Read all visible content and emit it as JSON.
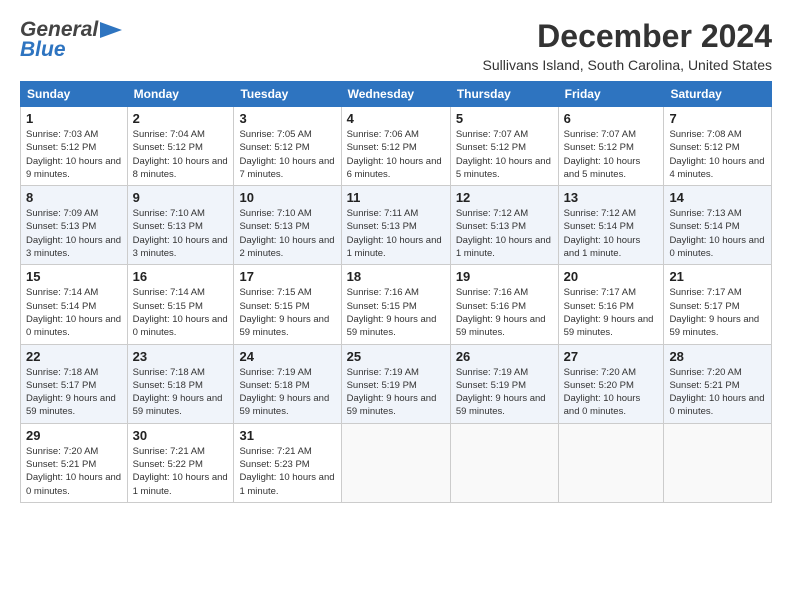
{
  "logo": {
    "line1": "General",
    "line2": "Blue"
  },
  "header": {
    "month_year": "December 2024",
    "location": "Sullivans Island, South Carolina, United States"
  },
  "days_of_week": [
    "Sunday",
    "Monday",
    "Tuesday",
    "Wednesday",
    "Thursday",
    "Friday",
    "Saturday"
  ],
  "weeks": [
    [
      {
        "day": "1",
        "sunrise": "Sunrise: 7:03 AM",
        "sunset": "Sunset: 5:12 PM",
        "daylight": "Daylight: 10 hours and 9 minutes."
      },
      {
        "day": "2",
        "sunrise": "Sunrise: 7:04 AM",
        "sunset": "Sunset: 5:12 PM",
        "daylight": "Daylight: 10 hours and 8 minutes."
      },
      {
        "day": "3",
        "sunrise": "Sunrise: 7:05 AM",
        "sunset": "Sunset: 5:12 PM",
        "daylight": "Daylight: 10 hours and 7 minutes."
      },
      {
        "day": "4",
        "sunrise": "Sunrise: 7:06 AM",
        "sunset": "Sunset: 5:12 PM",
        "daylight": "Daylight: 10 hours and 6 minutes."
      },
      {
        "day": "5",
        "sunrise": "Sunrise: 7:07 AM",
        "sunset": "Sunset: 5:12 PM",
        "daylight": "Daylight: 10 hours and 5 minutes."
      },
      {
        "day": "6",
        "sunrise": "Sunrise: 7:07 AM",
        "sunset": "Sunset: 5:12 PM",
        "daylight": "Daylight: 10 hours and 5 minutes."
      },
      {
        "day": "7",
        "sunrise": "Sunrise: 7:08 AM",
        "sunset": "Sunset: 5:12 PM",
        "daylight": "Daylight: 10 hours and 4 minutes."
      }
    ],
    [
      {
        "day": "8",
        "sunrise": "Sunrise: 7:09 AM",
        "sunset": "Sunset: 5:13 PM",
        "daylight": "Daylight: 10 hours and 3 minutes."
      },
      {
        "day": "9",
        "sunrise": "Sunrise: 7:10 AM",
        "sunset": "Sunset: 5:13 PM",
        "daylight": "Daylight: 10 hours and 3 minutes."
      },
      {
        "day": "10",
        "sunrise": "Sunrise: 7:10 AM",
        "sunset": "Sunset: 5:13 PM",
        "daylight": "Daylight: 10 hours and 2 minutes."
      },
      {
        "day": "11",
        "sunrise": "Sunrise: 7:11 AM",
        "sunset": "Sunset: 5:13 PM",
        "daylight": "Daylight: 10 hours and 1 minute."
      },
      {
        "day": "12",
        "sunrise": "Sunrise: 7:12 AM",
        "sunset": "Sunset: 5:13 PM",
        "daylight": "Daylight: 10 hours and 1 minute."
      },
      {
        "day": "13",
        "sunrise": "Sunrise: 7:12 AM",
        "sunset": "Sunset: 5:14 PM",
        "daylight": "Daylight: 10 hours and 1 minute."
      },
      {
        "day": "14",
        "sunrise": "Sunrise: 7:13 AM",
        "sunset": "Sunset: 5:14 PM",
        "daylight": "Daylight: 10 hours and 0 minutes."
      }
    ],
    [
      {
        "day": "15",
        "sunrise": "Sunrise: 7:14 AM",
        "sunset": "Sunset: 5:14 PM",
        "daylight": "Daylight: 10 hours and 0 minutes."
      },
      {
        "day": "16",
        "sunrise": "Sunrise: 7:14 AM",
        "sunset": "Sunset: 5:15 PM",
        "daylight": "Daylight: 10 hours and 0 minutes."
      },
      {
        "day": "17",
        "sunrise": "Sunrise: 7:15 AM",
        "sunset": "Sunset: 5:15 PM",
        "daylight": "Daylight: 9 hours and 59 minutes."
      },
      {
        "day": "18",
        "sunrise": "Sunrise: 7:16 AM",
        "sunset": "Sunset: 5:15 PM",
        "daylight": "Daylight: 9 hours and 59 minutes."
      },
      {
        "day": "19",
        "sunrise": "Sunrise: 7:16 AM",
        "sunset": "Sunset: 5:16 PM",
        "daylight": "Daylight: 9 hours and 59 minutes."
      },
      {
        "day": "20",
        "sunrise": "Sunrise: 7:17 AM",
        "sunset": "Sunset: 5:16 PM",
        "daylight": "Daylight: 9 hours and 59 minutes."
      },
      {
        "day": "21",
        "sunrise": "Sunrise: 7:17 AM",
        "sunset": "Sunset: 5:17 PM",
        "daylight": "Daylight: 9 hours and 59 minutes."
      }
    ],
    [
      {
        "day": "22",
        "sunrise": "Sunrise: 7:18 AM",
        "sunset": "Sunset: 5:17 PM",
        "daylight": "Daylight: 9 hours and 59 minutes."
      },
      {
        "day": "23",
        "sunrise": "Sunrise: 7:18 AM",
        "sunset": "Sunset: 5:18 PM",
        "daylight": "Daylight: 9 hours and 59 minutes."
      },
      {
        "day": "24",
        "sunrise": "Sunrise: 7:19 AM",
        "sunset": "Sunset: 5:18 PM",
        "daylight": "Daylight: 9 hours and 59 minutes."
      },
      {
        "day": "25",
        "sunrise": "Sunrise: 7:19 AM",
        "sunset": "Sunset: 5:19 PM",
        "daylight": "Daylight: 9 hours and 59 minutes."
      },
      {
        "day": "26",
        "sunrise": "Sunrise: 7:19 AM",
        "sunset": "Sunset: 5:19 PM",
        "daylight": "Daylight: 9 hours and 59 minutes."
      },
      {
        "day": "27",
        "sunrise": "Sunrise: 7:20 AM",
        "sunset": "Sunset: 5:20 PM",
        "daylight": "Daylight: 10 hours and 0 minutes."
      },
      {
        "day": "28",
        "sunrise": "Sunrise: 7:20 AM",
        "sunset": "Sunset: 5:21 PM",
        "daylight": "Daylight: 10 hours and 0 minutes."
      }
    ],
    [
      {
        "day": "29",
        "sunrise": "Sunrise: 7:20 AM",
        "sunset": "Sunset: 5:21 PM",
        "daylight": "Daylight: 10 hours and 0 minutes."
      },
      {
        "day": "30",
        "sunrise": "Sunrise: 7:21 AM",
        "sunset": "Sunset: 5:22 PM",
        "daylight": "Daylight: 10 hours and 1 minute."
      },
      {
        "day": "31",
        "sunrise": "Sunrise: 7:21 AM",
        "sunset": "Sunset: 5:23 PM",
        "daylight": "Daylight: 10 hours and 1 minute."
      },
      {
        "day": "",
        "sunrise": "",
        "sunset": "",
        "daylight": ""
      },
      {
        "day": "",
        "sunrise": "",
        "sunset": "",
        "daylight": ""
      },
      {
        "day": "",
        "sunrise": "",
        "sunset": "",
        "daylight": ""
      },
      {
        "day": "",
        "sunrise": "",
        "sunset": "",
        "daylight": ""
      }
    ]
  ]
}
